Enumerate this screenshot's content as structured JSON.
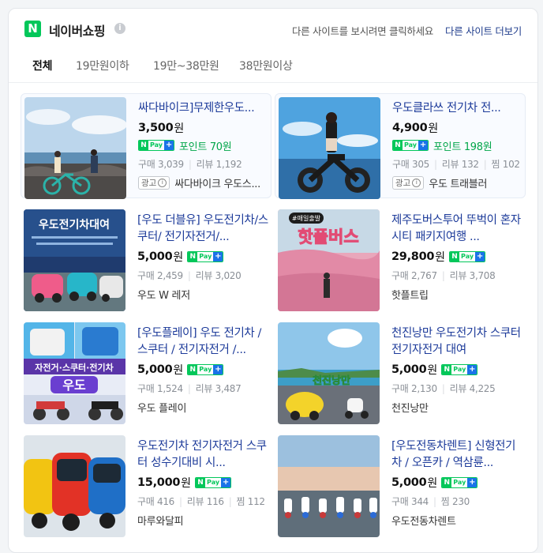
{
  "header": {
    "brand": "네이버쇼핑",
    "logo_letter": "N",
    "info_glyph": "i",
    "message": "다른 사이트를 보시려면 클릭하세요",
    "more_link": "다른 사이트 더보기"
  },
  "tabs": [
    {
      "label": "전체",
      "active": true
    },
    {
      "label": "19만원이하",
      "active": false
    },
    {
      "label": "19만~38만원",
      "active": false
    },
    {
      "label": "38만원이상",
      "active": false
    }
  ],
  "npay": {
    "n": "N",
    "pay": "Pay",
    "plus": "+"
  },
  "ad_label": "광고",
  "ad_icon": "i",
  "products": [
    {
      "title": "싸다바이크]무제한우도...",
      "price": "3,500",
      "unit": "원",
      "point": "포인트 70원",
      "stats": [
        "구매 3,039",
        "리뷰 1,192"
      ],
      "seller": "싸다바이크 우도스...",
      "ad": true,
      "image": "bicycle-couple-seaside"
    },
    {
      "title": "우도클라쓰 전기차 전...",
      "price": "4,900",
      "unit": "원",
      "point": "포인트 198원",
      "stats": [
        "구매 305",
        "리뷰 132",
        "찜 102"
      ],
      "seller": "우도 트래블러",
      "ad": true,
      "image": "woman-on-ebike"
    },
    {
      "title": "[우도 더블유] 우도전기차/스쿠터/ 전기자전거/...",
      "price": "5,000",
      "unit": "원",
      "stats": [
        "구매 2,459",
        "리뷰 3,020"
      ],
      "seller": "우도 W 레저",
      "ad": false,
      "image": "electric-car-rental-poster",
      "image_text": "우도전기차대여"
    },
    {
      "title": "제주도버스투어 뚜벅이 혼자 시티 패키지여행 ...",
      "price": "29,800",
      "unit": "원",
      "stats": [
        "구매 2,767",
        "리뷰 3,708"
      ],
      "seller": "핫플트립",
      "ad": false,
      "image": "pink-muhly-field",
      "image_text": "핫플버스",
      "image_tag": "#매일출발"
    },
    {
      "title": "[우도플레이] 우도 전기차 / 스쿠터 / 전기자전거 /...",
      "price": "5,000",
      "unit": "원",
      "stats": [
        "구매 1,524",
        "리뷰 3,487"
      ],
      "seller": "우도 플레이",
      "ad": false,
      "image": "vehicle-collage",
      "image_text": "자전거·스쿠터·전기차",
      "image_text2": "우도"
    },
    {
      "title": "천진낭만 우도전기차 스쿠터 전기자전거 대여",
      "price": "5,000",
      "unit": "원",
      "stats": [
        "구매 2,130",
        "리뷰 4,225"
      ],
      "seller": "천진낭만",
      "ad": false,
      "image": "yellow-car-scooter",
      "image_text": "천진낭만"
    },
    {
      "title": "우도전기차 전기자전거 스쿠터 성수기대비 시...",
      "price": "15,000",
      "unit": "원",
      "stats": [
        "구매 416",
        "리뷰 116",
        "찜 112"
      ],
      "seller": "마루와달피",
      "ad": false,
      "image": "red-electric-cars"
    },
    {
      "title": "[우도전동차렌트] 신형전기차 / 오픈카 / 역삼륜...",
      "price": "5,000",
      "unit": "원",
      "stats": [
        "구매 344",
        "찜 230"
      ],
      "seller": "우도전동차렌트",
      "ad": false,
      "image": "scooters-at-sunset"
    }
  ],
  "colors": {
    "naver_green": "#03c75a",
    "title_blue": "#1d3b9a",
    "point_green": "#03a64a",
    "plus_blue": "#1a73e8"
  }
}
